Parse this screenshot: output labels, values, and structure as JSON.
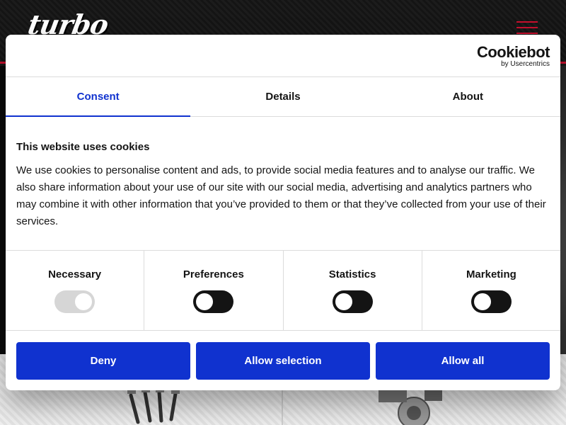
{
  "site": {
    "logo_text": "turbo"
  },
  "dialog": {
    "brand": {
      "name": "Cookiebot",
      "sub": "by Usercentrics"
    },
    "tabs": [
      {
        "label": "Consent",
        "active": true
      },
      {
        "label": "Details",
        "active": false
      },
      {
        "label": "About",
        "active": false
      }
    ],
    "title": "This website uses cookies",
    "description": "We use cookies to personalise content and ads, to provide social media features and to analyse our traffic. We also share information about your use of our site with our social media, advertising and analytics partners who may combine it with other information that you’ve provided to them or that they’ve collected from your use of their services.",
    "toggles": [
      {
        "label": "Necessary",
        "state": "on",
        "disabled": true
      },
      {
        "label": "Preferences",
        "state": "off",
        "disabled": false
      },
      {
        "label": "Statistics",
        "state": "off",
        "disabled": false
      },
      {
        "label": "Marketing",
        "state": "off",
        "disabled": false
      }
    ],
    "buttons": {
      "deny": "Deny",
      "allow_selection": "Allow selection",
      "allow_all": "Allow all"
    },
    "colors": {
      "accent": "#1032cf",
      "brand_red": "#c8102e"
    }
  }
}
